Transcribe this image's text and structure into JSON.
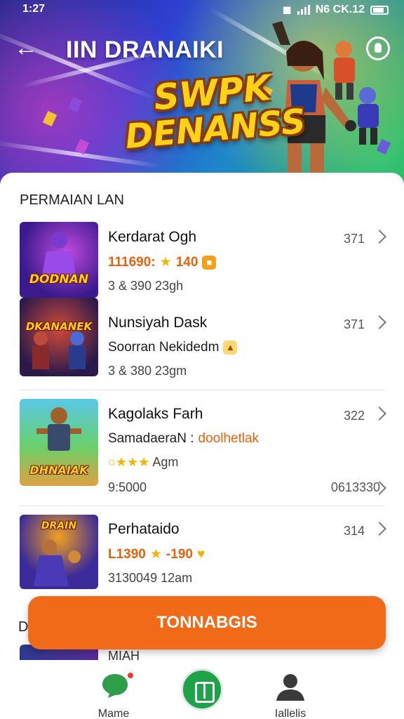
{
  "status_bar": {
    "time": "1:27",
    "right_text": "N6 CK.12",
    "icons": [
      "notification-icon",
      "signal-icon",
      "battery-icon"
    ]
  },
  "header": {
    "title": "IIN DRANAIKI",
    "banner_line1": "SWPK",
    "banner_line2": "DENANSS",
    "back_icon": "back-arrow-icon",
    "profile_icon": "profile-icon"
  },
  "section": {
    "title": "PERMAIAN LAN"
  },
  "games": [
    {
      "thumb_label": "DODNAN",
      "title": "Kerdarat Ogh",
      "sub_price": "111690:",
      "sub_rating": "140",
      "meta": "3  &  390    23gh",
      "count": "371"
    },
    {
      "thumb_label": "DKANANEK",
      "title": "Nunsiyah Dask",
      "sub_text": "Soorran Nekidedm",
      "meta": "3  &  380    23gm",
      "count": "371"
    },
    {
      "thumb_label": "DHNAIAK",
      "title": "Kagolaks Farh",
      "sub_text": "SamadaeraN :",
      "sub_link": "doolhetlak",
      "meta": "Agm",
      "extra_left": "9:5000",
      "extra_right": "0613330",
      "count": "322"
    },
    {
      "thumb_label": "DRAIN",
      "title": "Perhataido",
      "sub_price": "L1390",
      "sub_rating": "-190",
      "meta": "3130049    12am",
      "count": "314"
    }
  ],
  "cta": {
    "label": "TONNABGIS"
  },
  "peek": {
    "letter": "D",
    "text": "MIAH"
  },
  "tabs": [
    {
      "label": "Mame",
      "icon": "home-chat-icon"
    },
    {
      "label": "",
      "icon": "grid-icon"
    },
    {
      "label": "Iallelis",
      "icon": "person-icon"
    }
  ],
  "colors": {
    "accent": "#f06a17",
    "green": "#1fa34a",
    "star": "#f4b400"
  }
}
